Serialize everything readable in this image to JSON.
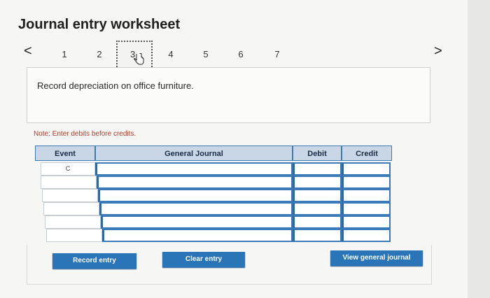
{
  "header": {
    "title": "Journal entry worksheet"
  },
  "pager": {
    "prev_icon": "chevron-left-icon",
    "next_icon": "chevron-right-icon",
    "prev_glyph": "<",
    "next_glyph": ">",
    "tabs": [
      "1",
      "2",
      "3",
      "4",
      "5",
      "6",
      "7"
    ],
    "active_tab": "3"
  },
  "instruction": {
    "text": "Record depreciation on office furniture."
  },
  "note": {
    "text": "Note: Enter debits before credits."
  },
  "grid": {
    "headers": {
      "event": "Event",
      "journal": "General Journal",
      "debit": "Debit",
      "credit": "Credit"
    },
    "rows": [
      {
        "event": "C",
        "journal": "",
        "debit": "",
        "credit": ""
      },
      {
        "event": "",
        "journal": "",
        "debit": "",
        "credit": ""
      },
      {
        "event": "",
        "journal": "",
        "debit": "",
        "credit": ""
      },
      {
        "event": "",
        "journal": "",
        "debit": "",
        "credit": ""
      },
      {
        "event": "",
        "journal": "",
        "debit": "",
        "credit": ""
      },
      {
        "event": "",
        "journal": "",
        "debit": "",
        "credit": ""
      }
    ]
  },
  "buttons": {
    "record": "Record entry",
    "clear": "Clear entry",
    "view": "View general journal"
  },
  "colors": {
    "accent": "#2a74b8",
    "note": "#b53a2a"
  }
}
